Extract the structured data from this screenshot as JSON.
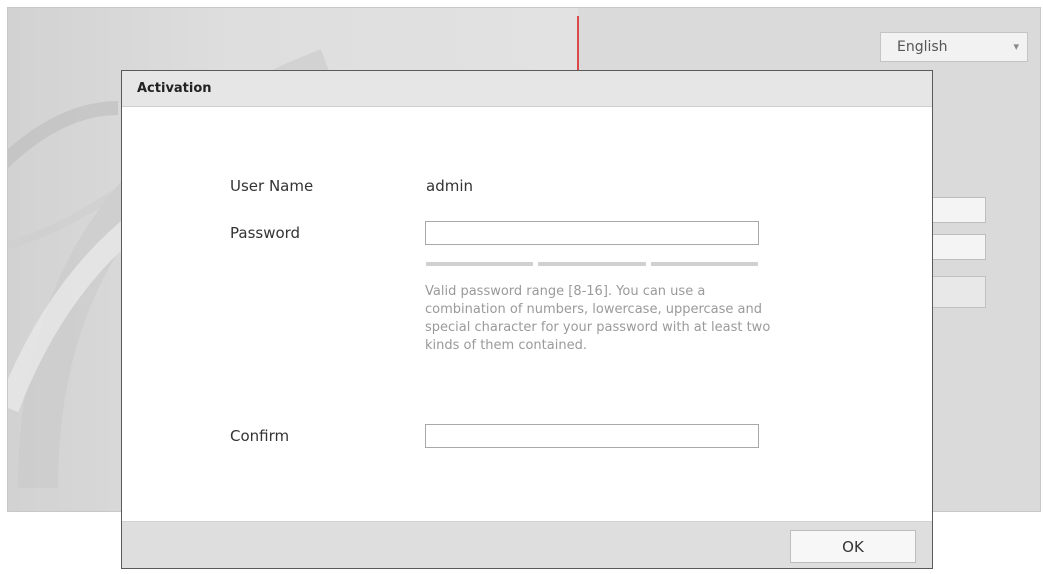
{
  "background": {
    "language_select": {
      "selected": "English"
    }
  },
  "dialog": {
    "title": "Activation",
    "username_label": "User Name",
    "username_value": "admin",
    "password_label": "Password",
    "password_value": "",
    "password_hint": "Valid password range [8-16]. You can use a combination of numbers, lowercase, uppercase and special character for your password with at least two kinds of them contained.",
    "confirm_label": "Confirm",
    "confirm_value": "",
    "ok_label": "OK"
  },
  "colors": {
    "accent_divider": "#d94b4b",
    "header_bg": "#e6e6e6",
    "footer_bg": "#dedede",
    "hint_text": "#9a9a9a"
  },
  "icons": {
    "language_dropdown": "chevron-down-icon"
  }
}
